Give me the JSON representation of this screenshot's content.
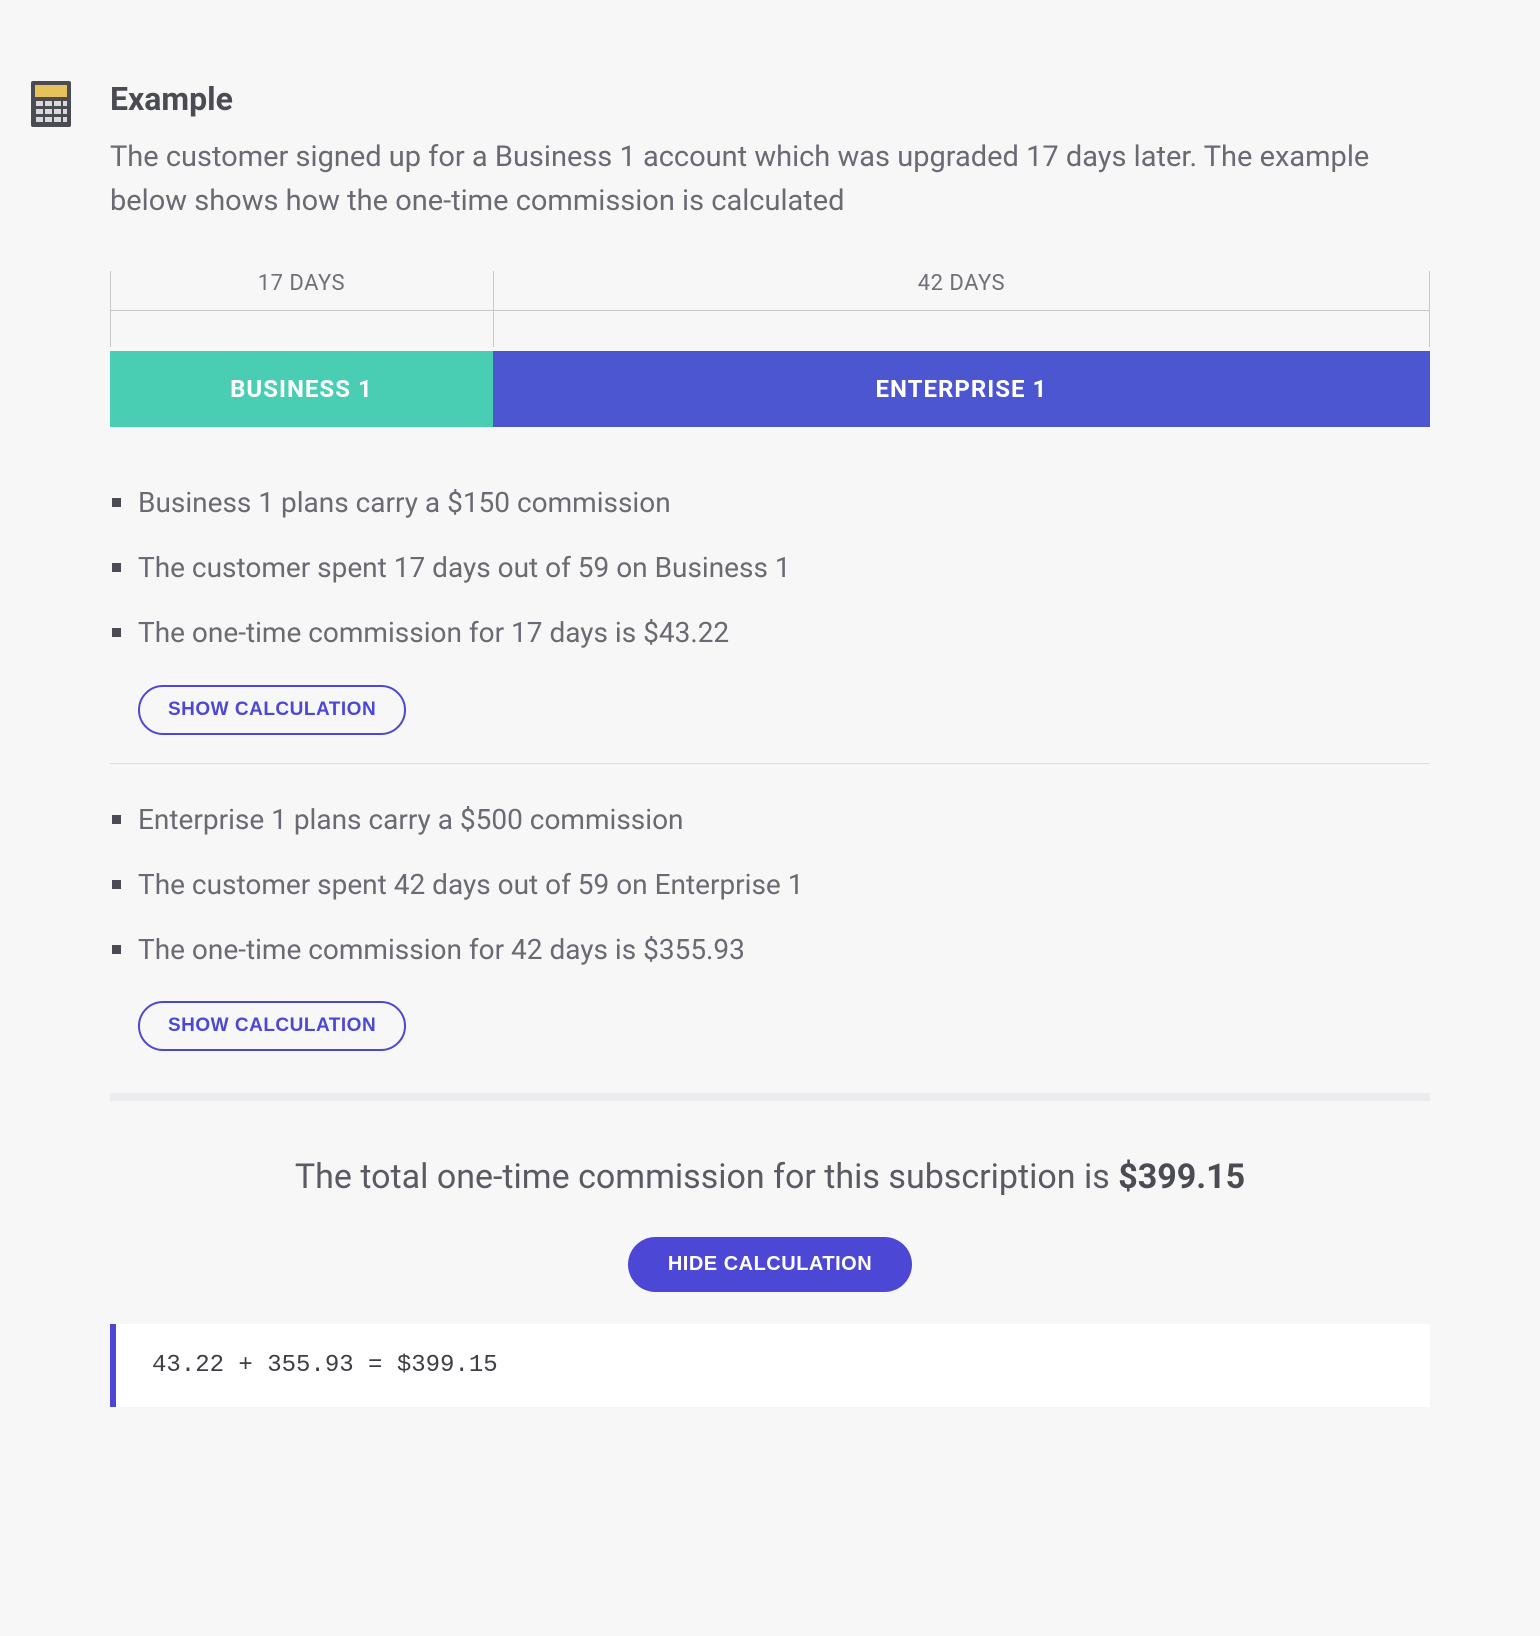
{
  "heading": "Example",
  "lead": "The customer signed up for a Business 1 account which was upgraded 17 days later. The example below shows how the one-time commission is calculated",
  "timeline": {
    "seg1": "17 DAYS",
    "seg2": "42 DAYS"
  },
  "plans": {
    "p1": "BUSINESS 1",
    "p2": "ENTERPRISE 1"
  },
  "biz": {
    "b1": "Business 1 plans carry a $150 commission",
    "b2": "The customer spent 17 days out of 59 on Business 1",
    "b3": "The one-time commission for 17 days is $43.22",
    "btn": "SHOW CALCULATION"
  },
  "ent": {
    "e1": "Enterprise 1 plans carry a $500 commission",
    "e2": "The customer spent 42 days out of 59 on Enterprise 1",
    "e3": "The one-time commission for 42 days is $355.93",
    "btn": "SHOW CALCULATION"
  },
  "total": {
    "prefix": "The total one-time commission for this subscription is ",
    "amount": "$399.15",
    "btn": "HIDE CALCULATION",
    "calc": "43.22 + 355.93 = $399.15"
  }
}
